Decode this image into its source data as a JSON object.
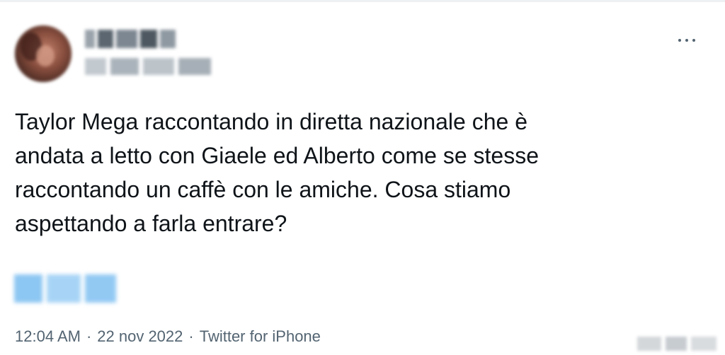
{
  "tweet": {
    "text": "Taylor Mega raccontando in diretta nazionale che è\nandata a letto con Giaele ed Alberto come se stesse\nraccontando un caffè con le amiche. Cosa stiamo\naspettando a farla entrare?",
    "time": "12:04 AM",
    "separator": "·",
    "date": "22 nov 2022",
    "source": "Twitter for iPhone"
  },
  "icons": {
    "more": "more-horizontal-icon"
  },
  "colors": {
    "text": "#0f1419",
    "meta": "#536471",
    "blurred_tag": "#8cc6f2"
  }
}
